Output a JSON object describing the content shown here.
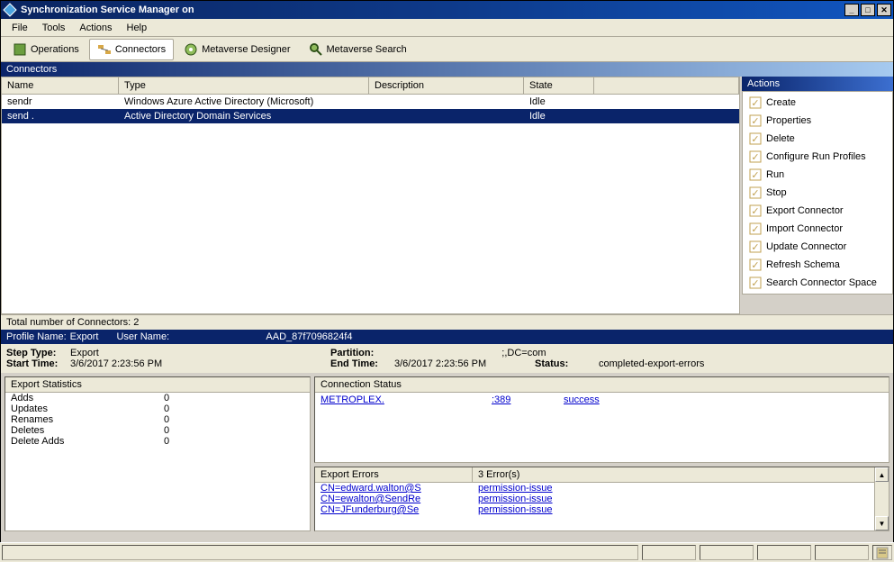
{
  "window": {
    "title": "Synchronization Service Manager on",
    "server_redacted": "          "
  },
  "menu": [
    "File",
    "Tools",
    "Actions",
    "Help"
  ],
  "toolbar": [
    {
      "label": "Operations",
      "icon": "operations",
      "active": false
    },
    {
      "label": "Connectors",
      "icon": "connectors",
      "active": true
    },
    {
      "label": "Metaverse Designer",
      "icon": "mv-designer",
      "active": false
    },
    {
      "label": "Metaverse Search",
      "icon": "mv-search",
      "active": false
    }
  ],
  "connectors": {
    "header": "Connectors",
    "columns": [
      "Name",
      "Type",
      "Description",
      "State"
    ],
    "rows": [
      {
        "name": "sendr",
        "type": "Windows Azure Active Directory (Microsoft)",
        "desc": "",
        "state": "Idle",
        "selected": false
      },
      {
        "name": "send                .",
        "type": "Active Directory Domain Services",
        "desc": "",
        "state": "Idle",
        "selected": true
      }
    ],
    "footer": "Total number of Connectors: 2"
  },
  "actions": {
    "header": "Actions",
    "items": [
      "Create",
      "Properties",
      "Delete",
      "Configure Run Profiles",
      "Run",
      "Stop",
      "Export Connector",
      "Import Connector",
      "Update Connector",
      "Refresh Schema",
      "Search Connector Space"
    ]
  },
  "profile": {
    "name_label": "Profile Name:",
    "name": "Export",
    "user_label": "User Name:",
    "user": "                                  AAD_87f7096824f4"
  },
  "detail": {
    "step_type_label": "Step Type:",
    "step_type": "Export",
    "start_label": "Start Time:",
    "start": "3/6/2017 2:23:56 PM",
    "partition_label": "Partition:",
    "partition": "                                         ;,DC=com",
    "end_label": "End Time:",
    "end": "3/6/2017 2:23:56 PM",
    "status_label": "Status:",
    "status": "completed-export-errors"
  },
  "export_stats": {
    "header": "Export Statistics",
    "rows": [
      {
        "label": "Adds",
        "value": "0"
      },
      {
        "label": "Updates",
        "value": "0"
      },
      {
        "label": "Renames",
        "value": "0"
      },
      {
        "label": "Deletes",
        "value": "0"
      },
      {
        "label": "Delete Adds",
        "value": "0"
      }
    ]
  },
  "conn_status": {
    "header": "Connection Status",
    "host": "METROPLEX.",
    "port": ":389",
    "result": "success"
  },
  "export_errors": {
    "header": "Export Errors",
    "count_header": "3 Error(s)",
    "rows": [
      {
        "cn": "CN=edward.walton@S",
        "err": "permission-issue"
      },
      {
        "cn": "CN=ewalton@SendRe",
        "err": "permission-issue"
      },
      {
        "cn": "CN=JFunderburg@Se",
        "err": "permission-issue"
      }
    ]
  }
}
